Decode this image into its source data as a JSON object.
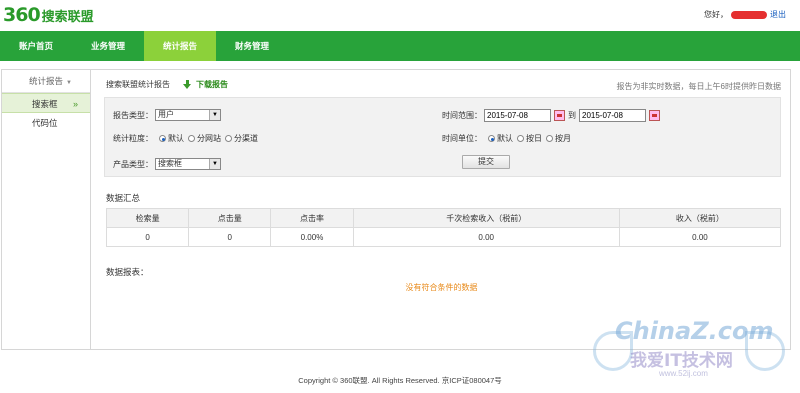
{
  "brand": {
    "mark": "360",
    "name": "搜索联盟"
  },
  "user": {
    "greeting": "您好，",
    "logout": "退出"
  },
  "nav": [
    {
      "label": "账户首页",
      "active": false
    },
    {
      "label": "业务管理",
      "active": false
    },
    {
      "label": "统计报告",
      "active": true
    },
    {
      "label": "财务管理",
      "active": false
    }
  ],
  "sidebar": {
    "heading": "统计报告",
    "items": [
      {
        "label": "搜索框",
        "active": true
      },
      {
        "label": "代码位",
        "active": false
      }
    ]
  },
  "content": {
    "title": "搜索联盟统计报告",
    "download": "下载报告",
    "notice": "报告为非实时数据，每日上午6时提供昨日数据"
  },
  "filter": {
    "report_type_label": "报告类型：",
    "report_type_value": "用户",
    "granularity_label": "统计粒度：",
    "granularity_options": [
      "默认",
      "分网站",
      "分渠道"
    ],
    "product_type_label": "产品类型：",
    "product_type_value": "搜索框",
    "time_range_label": "时间范围：",
    "start_date": "2015-07-08",
    "to": "到",
    "end_date": "2015-07-08",
    "time_unit_label": "时间单位：",
    "time_unit_options": [
      "默认",
      "按日",
      "按月"
    ],
    "submit": "提交"
  },
  "summary": {
    "title": "数据汇总",
    "columns": [
      "检索量",
      "点击量",
      "点击率",
      "千次检索收入（税前）",
      "收入（税前）"
    ],
    "row": [
      "0",
      "0",
      "0.00%",
      "0.00",
      "0.00"
    ]
  },
  "report": {
    "title": "数据报表：",
    "empty": "没有符合条件的数据"
  },
  "footer": "Copyright © 360联盟. All Rights Reserved. 京ICP证080047号",
  "watermark": {
    "logo": "ChinaZ.com",
    "cn": "我爱IT技术网",
    "url": "www.52ij.com"
  },
  "colors": {
    "nav_bg": "#28a33a",
    "nav_active": "#8cd13a",
    "brand": "#2a9a2a",
    "empty_msg": "#e88a1a"
  }
}
